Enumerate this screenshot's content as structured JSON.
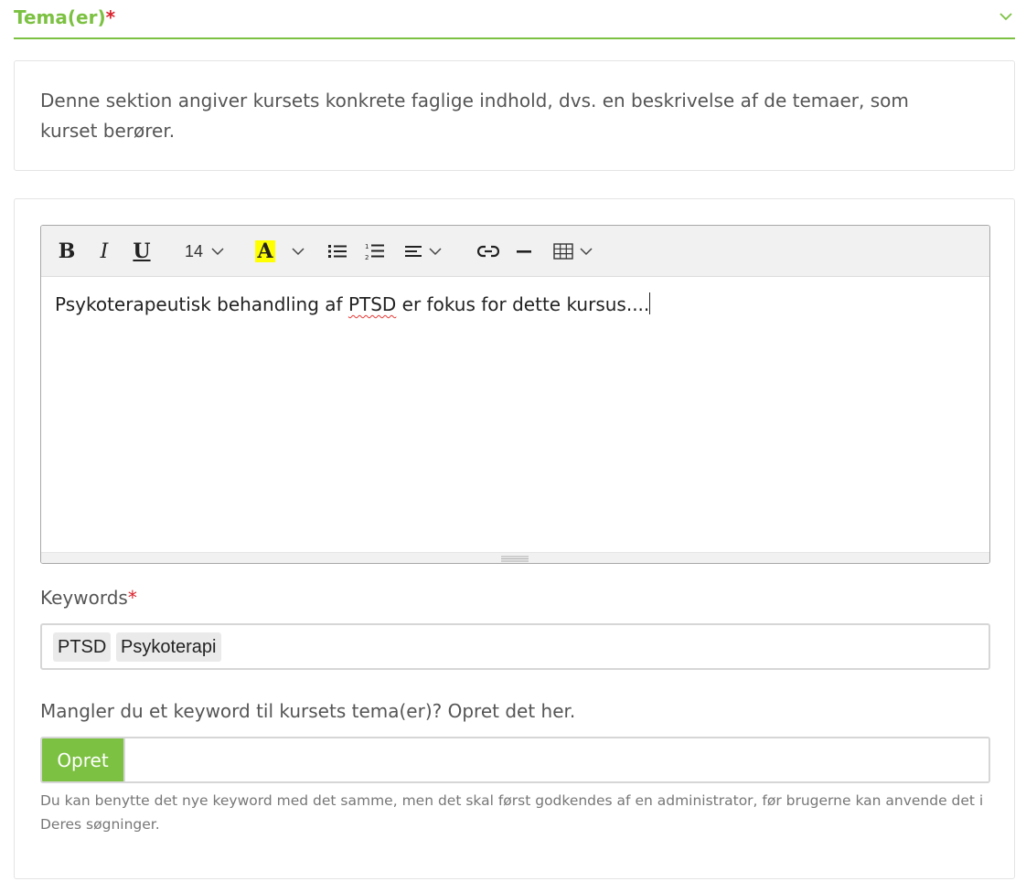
{
  "section": {
    "title": "Tema(er)",
    "required_mark": "*",
    "description": "Denne sektion angiver kursets konkrete faglige indhold, dvs. en beskrivelse af de temaer, som kurset berører."
  },
  "editor": {
    "toolbar": {
      "bold_label": "B",
      "italic_label": "I",
      "underline_label": "U",
      "font_size": "14",
      "highlight_label": "A",
      "highlight_color": "#ffff00"
    },
    "content_before": "Psykoterapeutisk behandling af ",
    "content_misspelled": "PTSD",
    "content_after": " er fokus for dette kursus...."
  },
  "keywords": {
    "label": "Keywords",
    "required_mark": "*",
    "tags": [
      "PTSD",
      "Psykoterapi"
    ]
  },
  "create_keyword": {
    "prompt": "Mangler du et keyword til kursets tema(er)? Opret det her.",
    "button_label": "Opret",
    "input_value": "",
    "help_text": "Du kan benytte det nye keyword med det samme, men det skal først godkendes af en administrator, før brugerne kan anvende det i Deres søgninger."
  },
  "colors": {
    "accent": "#7cc142",
    "required": "#d9232d",
    "spellcheck": "#e53935"
  }
}
